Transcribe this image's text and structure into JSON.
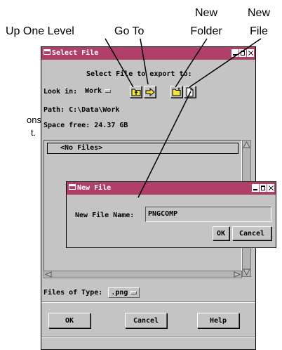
{
  "callouts": {
    "up_one_level": "Up One Level",
    "go_to": "Go To",
    "new_folder_line1": "New",
    "new_folder_line2": "Folder",
    "new_file_line1": "New",
    "new_file_line2": "File",
    "side_note_line1": "ons",
    "side_note_line2": "t."
  },
  "select_file_dialog": {
    "title": "Select File",
    "prompt": "Select File to export to:",
    "look_in_label": "Look in:",
    "look_in_value": "Work",
    "path_label": "Path:",
    "path_value": "C:\\Data\\Work",
    "space_label": "Space free:",
    "space_value": "24.37 GB",
    "list_header": "<No Files>",
    "files_of_type_label": "Files of Type:",
    "files_of_type_value": ".png",
    "ok_label": "OK",
    "cancel_label": "Cancel",
    "help_label": "Help"
  },
  "new_file_dialog": {
    "title": "New File",
    "field_label": "New File Name:",
    "field_value": "PNGCOMP",
    "ok_label": "OK",
    "cancel_label": "Cancel"
  },
  "colors": {
    "titlebar": "#b0406a",
    "window_bg": "#c4c4c4",
    "folder_yellow": "#f5e63c"
  },
  "icons": [
    "up-folder-icon",
    "goto-arrow-icon",
    "new-folder-icon",
    "new-file-icon",
    "window-icon",
    "minimize-icon",
    "maximize-icon",
    "close-icon"
  ]
}
